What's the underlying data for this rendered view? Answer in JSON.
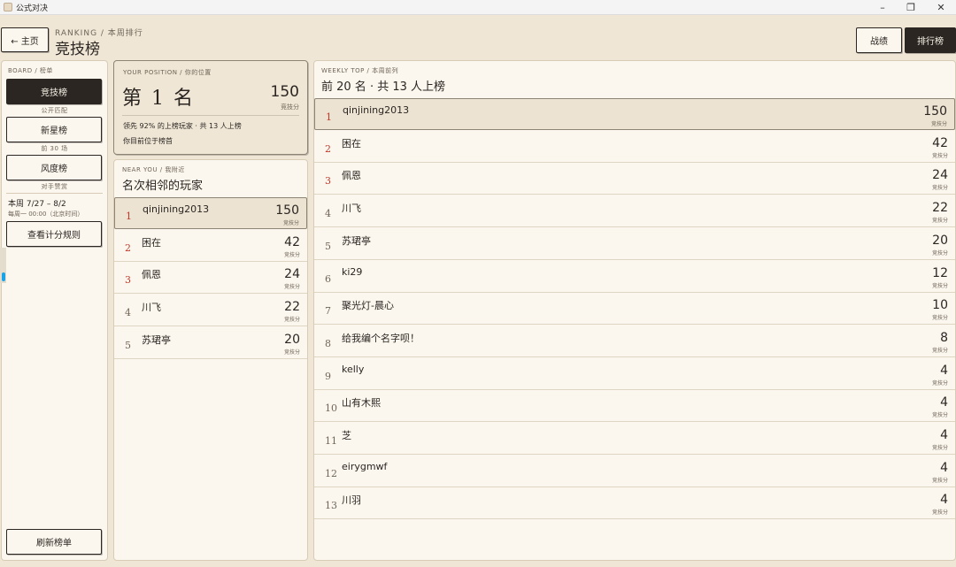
{
  "window": {
    "title": "公式对决",
    "min_icon": "minimize-icon",
    "max_icon": "restore-icon",
    "close_icon": "close-icon"
  },
  "header": {
    "back_label": "← 主页",
    "crumb": "RANKING / 本周排行",
    "title": "竞技榜",
    "tabs": [
      {
        "label": "战绩"
      },
      {
        "label": "排行榜"
      }
    ]
  },
  "sidebar": {
    "section": "BOARD / 榜单",
    "boards": [
      {
        "label": "竞技榜",
        "sub": "公开匹配",
        "active": true
      },
      {
        "label": "新星榜",
        "sub": "前 30 场"
      },
      {
        "label": "风度榜",
        "sub": "对手赞赏"
      }
    ],
    "week": "本周 7/27 – 8/2",
    "reset": "每周一 00:00（北京时间）",
    "rules_btn": "查看计分规则",
    "refresh_btn": "刷新榜单"
  },
  "position": {
    "section": "YOUR POSITION / 你的位置",
    "rank_text": "第 1 名",
    "score": "150",
    "unit": "竞技分",
    "lead": "领先 92% 的上榜玩家 · 共 13 人上榜",
    "note": "你目前位于榜首"
  },
  "near": {
    "section": "NEAR YOU / 我附近",
    "title": "名次相邻的玩家",
    "rows": [
      {
        "rank": "1",
        "name": "qinjining2013",
        "score": "150",
        "unit": "竞技分"
      },
      {
        "rank": "2",
        "name": "困在",
        "score": "42",
        "unit": "竞技分"
      },
      {
        "rank": "3",
        "name": "佩恩",
        "score": "24",
        "unit": "竞技分"
      },
      {
        "rank": "4",
        "name": "川飞",
        "score": "22",
        "unit": "竞技分"
      },
      {
        "rank": "5",
        "name": "苏珺亭",
        "score": "20",
        "unit": "竞技分"
      }
    ]
  },
  "weekly": {
    "section": "WEEKLY TOP / 本周前列",
    "title": "前 20 名 · 共 13 人上榜",
    "rows": [
      {
        "rank": "1",
        "name": "qinjining2013",
        "score": "150",
        "unit": "竞技分"
      },
      {
        "rank": "2",
        "name": "困在",
        "score": "42",
        "unit": "竞技分"
      },
      {
        "rank": "3",
        "name": "佩恩",
        "score": "24",
        "unit": "竞技分"
      },
      {
        "rank": "4",
        "name": "川飞",
        "score": "22",
        "unit": "竞技分"
      },
      {
        "rank": "5",
        "name": "苏珺亭",
        "score": "20",
        "unit": "竞技分"
      },
      {
        "rank": "6",
        "name": "ki29",
        "score": "12",
        "unit": "竞技分"
      },
      {
        "rank": "7",
        "name": "聚光灯-晨心",
        "score": "10",
        "unit": "竞技分"
      },
      {
        "rank": "8",
        "name": "给我编个名字呗！",
        "score": "8",
        "unit": "竞技分"
      },
      {
        "rank": "9",
        "name": "kelly",
        "score": "4",
        "unit": "竞技分"
      },
      {
        "rank": "10",
        "name": "山有木熙",
        "score": "4",
        "unit": "竞技分"
      },
      {
        "rank": "11",
        "name": "芝",
        "score": "4",
        "unit": "竞技分"
      },
      {
        "rank": "12",
        "name": "eirygmwf",
        "score": "4",
        "unit": "竞技分"
      },
      {
        "rank": "13",
        "name": "川羽",
        "score": "4",
        "unit": "竞技分"
      }
    ]
  },
  "colors": {
    "accent": "#c0392b",
    "ink": "#2b2622",
    "paper": "#fbf7ee",
    "bg": "#efe6d6"
  }
}
